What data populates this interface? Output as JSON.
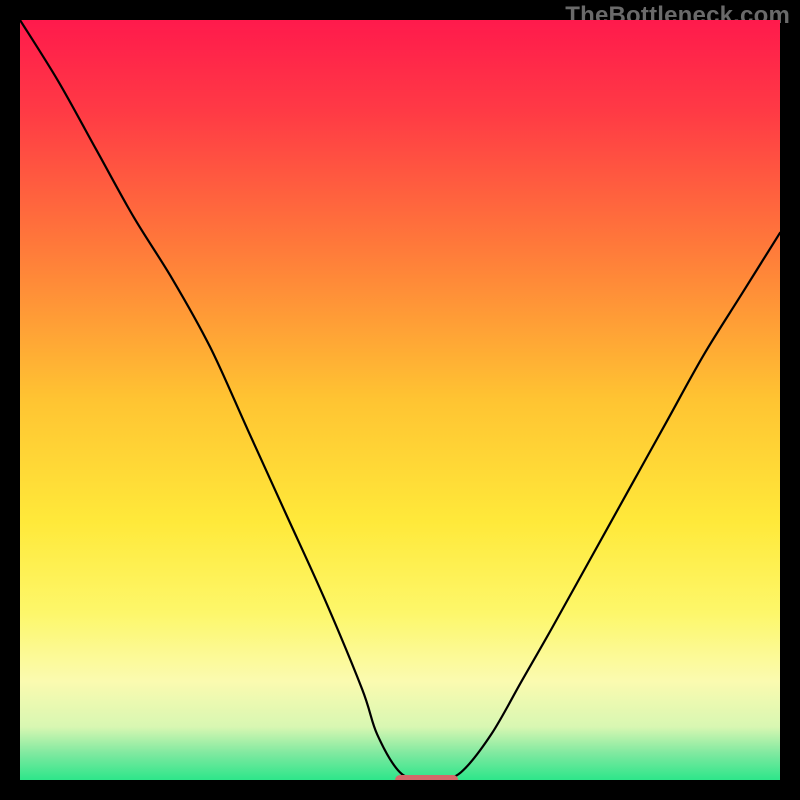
{
  "watermark": "TheBottleneck.com",
  "chart_data": {
    "type": "line",
    "title": "",
    "xlabel": "",
    "ylabel": "",
    "xlim": [
      0,
      100
    ],
    "ylim": [
      0,
      100
    ],
    "grid": false,
    "legend": false,
    "background_gradient": {
      "stops": [
        {
          "pos": 0.0,
          "color": "#ff1a4c"
        },
        {
          "pos": 0.12,
          "color": "#ff3a45"
        },
        {
          "pos": 0.3,
          "color": "#ff7a3a"
        },
        {
          "pos": 0.5,
          "color": "#ffc432"
        },
        {
          "pos": 0.66,
          "color": "#ffe93a"
        },
        {
          "pos": 0.78,
          "color": "#fdf76a"
        },
        {
          "pos": 0.87,
          "color": "#fbfbb0"
        },
        {
          "pos": 0.93,
          "color": "#d8f7b2"
        },
        {
          "pos": 0.965,
          "color": "#7fe9a0"
        },
        {
          "pos": 1.0,
          "color": "#2de68a"
        }
      ]
    },
    "curve": {
      "x": [
        0,
        5,
        10,
        15,
        20,
        25,
        30,
        35,
        40,
        45,
        47,
        50,
        53,
        55,
        58,
        62,
        66,
        70,
        75,
        80,
        85,
        90,
        95,
        100
      ],
      "y": [
        100,
        92,
        83,
        74,
        66,
        57,
        46,
        35,
        24,
        12,
        6,
        1,
        0,
        0,
        1,
        6,
        13,
        20,
        29,
        38,
        47,
        56,
        64,
        72
      ]
    },
    "marker": {
      "x_start": 50,
      "x_end": 57,
      "y": 0,
      "color": "#d46a6a",
      "thickness": 2.4
    }
  }
}
